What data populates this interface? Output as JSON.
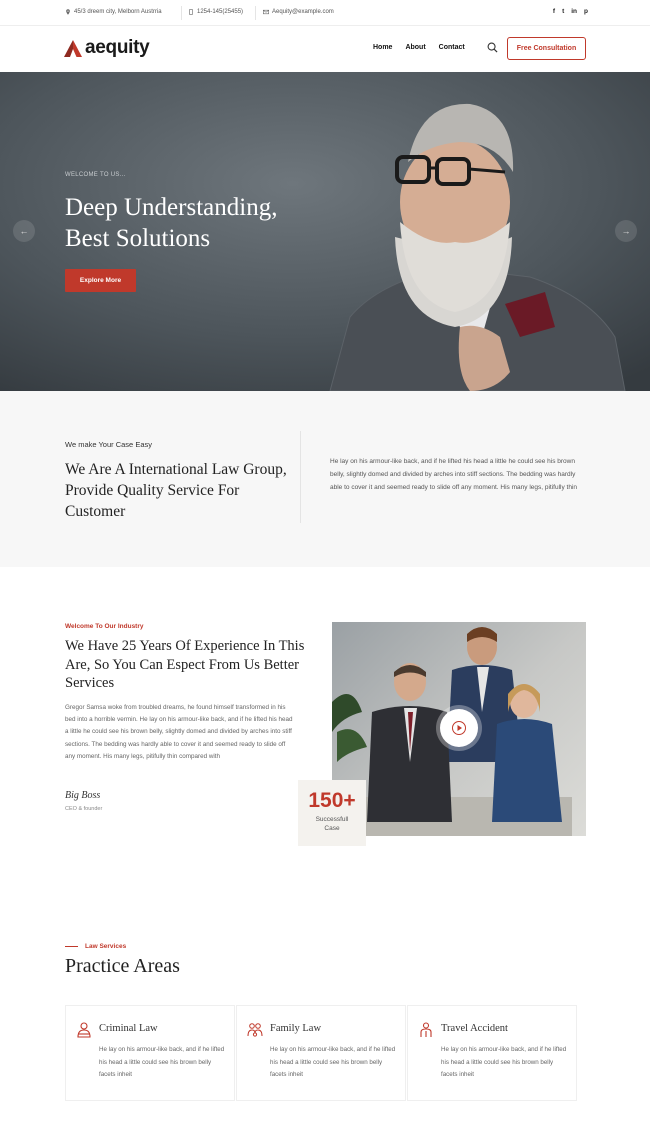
{
  "topbar": {
    "address": "45/3 dreem city, Melborn Austrria",
    "phone": "1254-145(25455)",
    "email": "Aequity@example.com",
    "social": [
      "f",
      "t",
      "in",
      "p"
    ]
  },
  "header": {
    "logo_text": "aequity",
    "nav": [
      "Home",
      "About",
      "Contact"
    ],
    "cta": "Free Consultation"
  },
  "hero": {
    "eyebrow": "WELCOME TO US...",
    "title_line1": "Deep Understanding,",
    "title_line2": "Best Solutions",
    "button": "Explore More",
    "prev_arrow": "←",
    "next_arrow": "→"
  },
  "about": {
    "eyebrow": "We make Your Case Easy",
    "title": "We Are A International Law Group, Provide Quality Service For Customer",
    "text": "He lay on his armour-like back, and if he lifted his head a little he could see his brown belly, slightly domed and divided by arches into stiff sections. The bedding was hardly able to cover it and seemed ready to slide off any moment. His many legs, pitifully thin"
  },
  "experience": {
    "eyebrow": "Welcome To Our Industry",
    "title": "We Have 25 Years Of Experience In This Are, So You Can Espect From Us Better Services",
    "text": "Gregor Samsa woke from troubled dreams, he found himself transformed in his bed into a horrible vermin. He lay on his armour-like back, and if he lifted his head a little he could see his brown belly, slightly domed and divided by arches into stiff sections. The bedding was hardly able to cover it and seemed ready to slide off any moment. His many legs, pitifully thin compared with",
    "signature": "Big Boss",
    "role": "CEO & founder",
    "counter_value": "150+",
    "counter_label_1": "Successfull",
    "counter_label_2": "Case"
  },
  "practice": {
    "eyebrow": "Law Services",
    "title": "Practice Areas",
    "cards": [
      {
        "title": "Criminal Law",
        "text": "He lay on his armour-like back, and if he lifted his head a little could see his brown belly facets inheit",
        "icon": "criminal-law-icon"
      },
      {
        "title": "Family Law",
        "text": "He lay on his armour-like back, and if he lifted his head a little could see his brown belly facets inheit",
        "icon": "family-law-icon"
      },
      {
        "title": "Travel Accident",
        "text": "He lay on his armour-like back, and if he lifted his head a little could see his brown belly facets inheit",
        "icon": "travel-accident-icon"
      }
    ]
  },
  "colors": {
    "accent": "#c0392b",
    "dark": "#222222"
  }
}
